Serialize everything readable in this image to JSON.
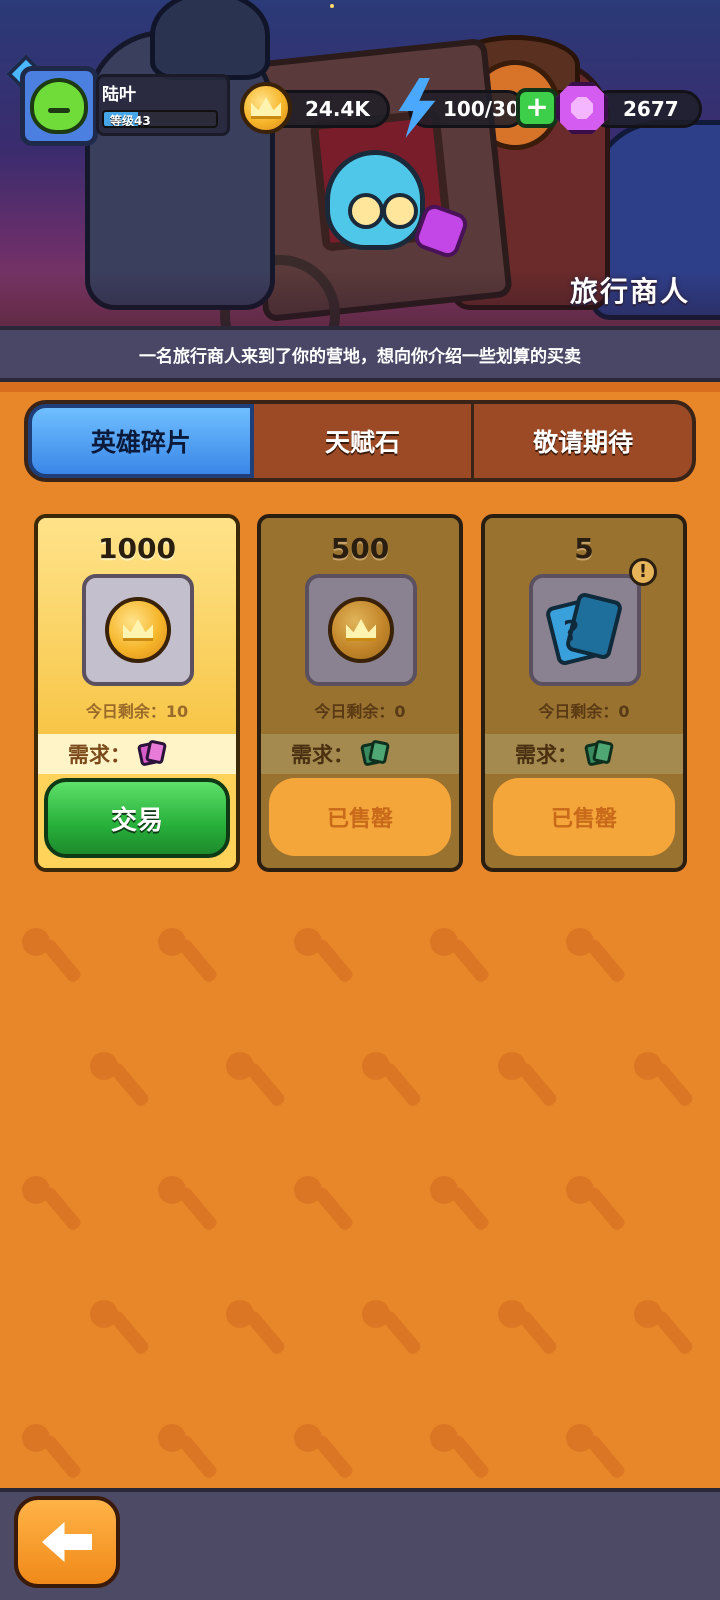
{
  "player": {
    "name": "陆叶",
    "level_label": "等级43",
    "level_progress": 0.3
  },
  "resources": {
    "coins": "24.4K",
    "energy": "100/30",
    "gems": "2677",
    "plus_label": "+"
  },
  "banner": {
    "title": "旅行商人"
  },
  "info_text": "一名旅行商人来到了你的营地，想向你介绍一些划算的买卖",
  "tabs": [
    {
      "label": "英雄碎片",
      "active": true
    },
    {
      "label": "天赋石",
      "active": false
    },
    {
      "label": "敬请期待",
      "active": false
    }
  ],
  "offers": [
    {
      "price": "1000",
      "item_icon": "coin-icon",
      "remaining": "今日剩余：10",
      "require_label": "需求：",
      "require_icon": "hero-card-pink-icon",
      "button": "交易",
      "sold_out": false
    },
    {
      "price": "500",
      "item_icon": "coin-icon",
      "remaining": "今日剩余：0",
      "require_label": "需求：",
      "require_icon": "hero-card-green-icon",
      "button": "已售罄",
      "sold_out": true
    },
    {
      "price": "5",
      "item_icon": "mystery-card-icon",
      "remaining": "今日剩余：0",
      "require_label": "需求：",
      "require_icon": "hero-card-green-icon",
      "button": "已售罄",
      "sold_out": true,
      "alert": "!"
    }
  ],
  "icons": {
    "back": "back-arrow-icon"
  },
  "colors": {
    "background": "#e8862a",
    "tab_active": "#3a86e8",
    "trade_button": "#27b03a",
    "soldout_button": "#f4a63a"
  }
}
